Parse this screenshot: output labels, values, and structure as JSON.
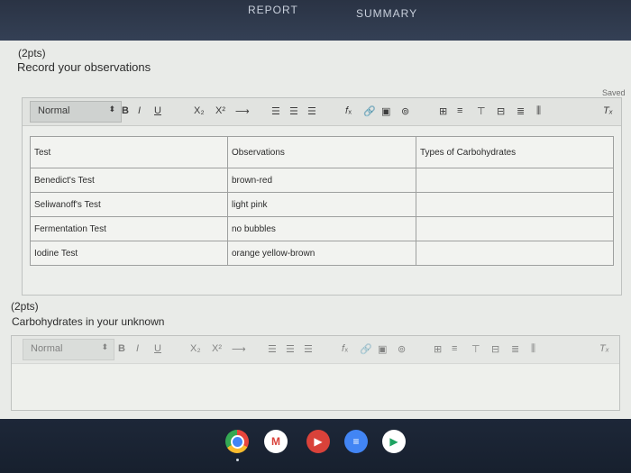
{
  "tabs": {
    "report": "REPORT",
    "summary": "SUMMARY"
  },
  "q1": {
    "points": "(2pts)",
    "prompt": "Record your observations"
  },
  "save_status": "Saved",
  "toolbar": {
    "style_value": "Normal",
    "style_arrow": "⬍",
    "bold": "B",
    "italic": "I",
    "underline": "U",
    "subscript": "X₂",
    "superscript": "X²",
    "special": "⟶",
    "ordered_list": "☰",
    "unordered_list": "☰",
    "align": "☰",
    "formula": "𝑓ₓ",
    "link": "🔗",
    "image": "▣",
    "embed": "⊚",
    "table": "⊞",
    "table_ops": "≡",
    "table_col": "⊤",
    "table_merge": "⊟",
    "table_rows": "≣",
    "table_cols": "⫼",
    "clear_format": "Tₓ"
  },
  "table": {
    "header": [
      "Test",
      "Observations",
      "Types of Carbohydrates"
    ],
    "rows": [
      [
        "Benedict's Test",
        "brown-red",
        ""
      ],
      [
        "Seliwanoff's Test",
        "light pink",
        ""
      ],
      [
        "Fermentation Test",
        "no bubbles",
        ""
      ],
      [
        "Iodine Test",
        "orange yellow-brown",
        ""
      ]
    ]
  },
  "q2": {
    "points": "(2pts)",
    "prompt": "Carbohydrates in your unknown"
  },
  "dock": {
    "chrome": "",
    "gmail": "M",
    "youtube": "▶",
    "docs": "≡",
    "play": "▶"
  }
}
